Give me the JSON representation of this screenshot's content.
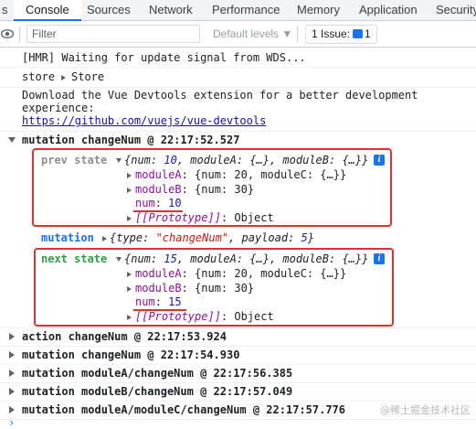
{
  "tabs": [
    "s",
    "Console",
    "Sources",
    "Network",
    "Performance",
    "Memory",
    "Application",
    "Security"
  ],
  "toolbar": {
    "filter_placeholder": "Filter",
    "levels": "Default levels ▼",
    "issue_count": "1 Issue:",
    "issue_num": "1"
  },
  "log": {
    "hmr": "[HMR] Waiting for update signal from WDS...",
    "store_label": "store",
    "store_value": "Store",
    "devtools_line1": "Download the Vue Devtools extension for a better development",
    "devtools_line2": "experience:",
    "devtools_link": "https://github.com/vuejs/vue-devtools",
    "group1": "mutation changeNum @ 22:17:52.527",
    "prev_label": "prev state",
    "prev_summary_pre": "{",
    "prev_summary_num_key": "num",
    "prev_summary_num_val": "10",
    "prev_summary_rest": ", moduleA: {…}, moduleB: {…}}",
    "prev_moduleA_key": "moduleA",
    "prev_moduleA_val": "{num: 20, moduleC: {…}}",
    "prev_moduleB_key": "moduleB",
    "prev_moduleB_val": "{num: 30}",
    "prev_num_key": "num",
    "prev_num_val": "10",
    "proto_key": "[[Prototype]]",
    "proto_val": "Object",
    "mutation_label": "mutation",
    "mutation_pre": "{type: ",
    "mutation_type": "\"changeNum\"",
    "mutation_mid": ", payload: ",
    "mutation_payload": "5",
    "mutation_post": "}",
    "next_label": "next state",
    "next_summary_pre": "{",
    "next_summary_num_key": "num",
    "next_summary_num_val": "15",
    "next_summary_rest": ", moduleA: {…}, moduleB: {…}}",
    "next_moduleA_key": "moduleA",
    "next_moduleA_val": "{num: 20, moduleC: {…}}",
    "next_moduleB_key": "moduleB",
    "next_moduleB_val": "{num: 30}",
    "next_num_key": "num",
    "next_num_val": "15",
    "group2": "action changeNum @ 22:17:53.924",
    "group3": "mutation changeNum @ 22:17:54.930",
    "group4": "mutation moduleA/changeNum @ 22:17:56.385",
    "group5": "mutation moduleB/changeNum @ 22:17:57.049",
    "group6": "mutation moduleA/moduleC/changeNum @ 22:17:57.776",
    "watermark": "@稀土掘金技术社区"
  },
  "colors": {
    "accent": "#1a73e8",
    "highlight": "#e03131",
    "state_label": "#8e8e93",
    "next_label": "#2f9e44"
  }
}
